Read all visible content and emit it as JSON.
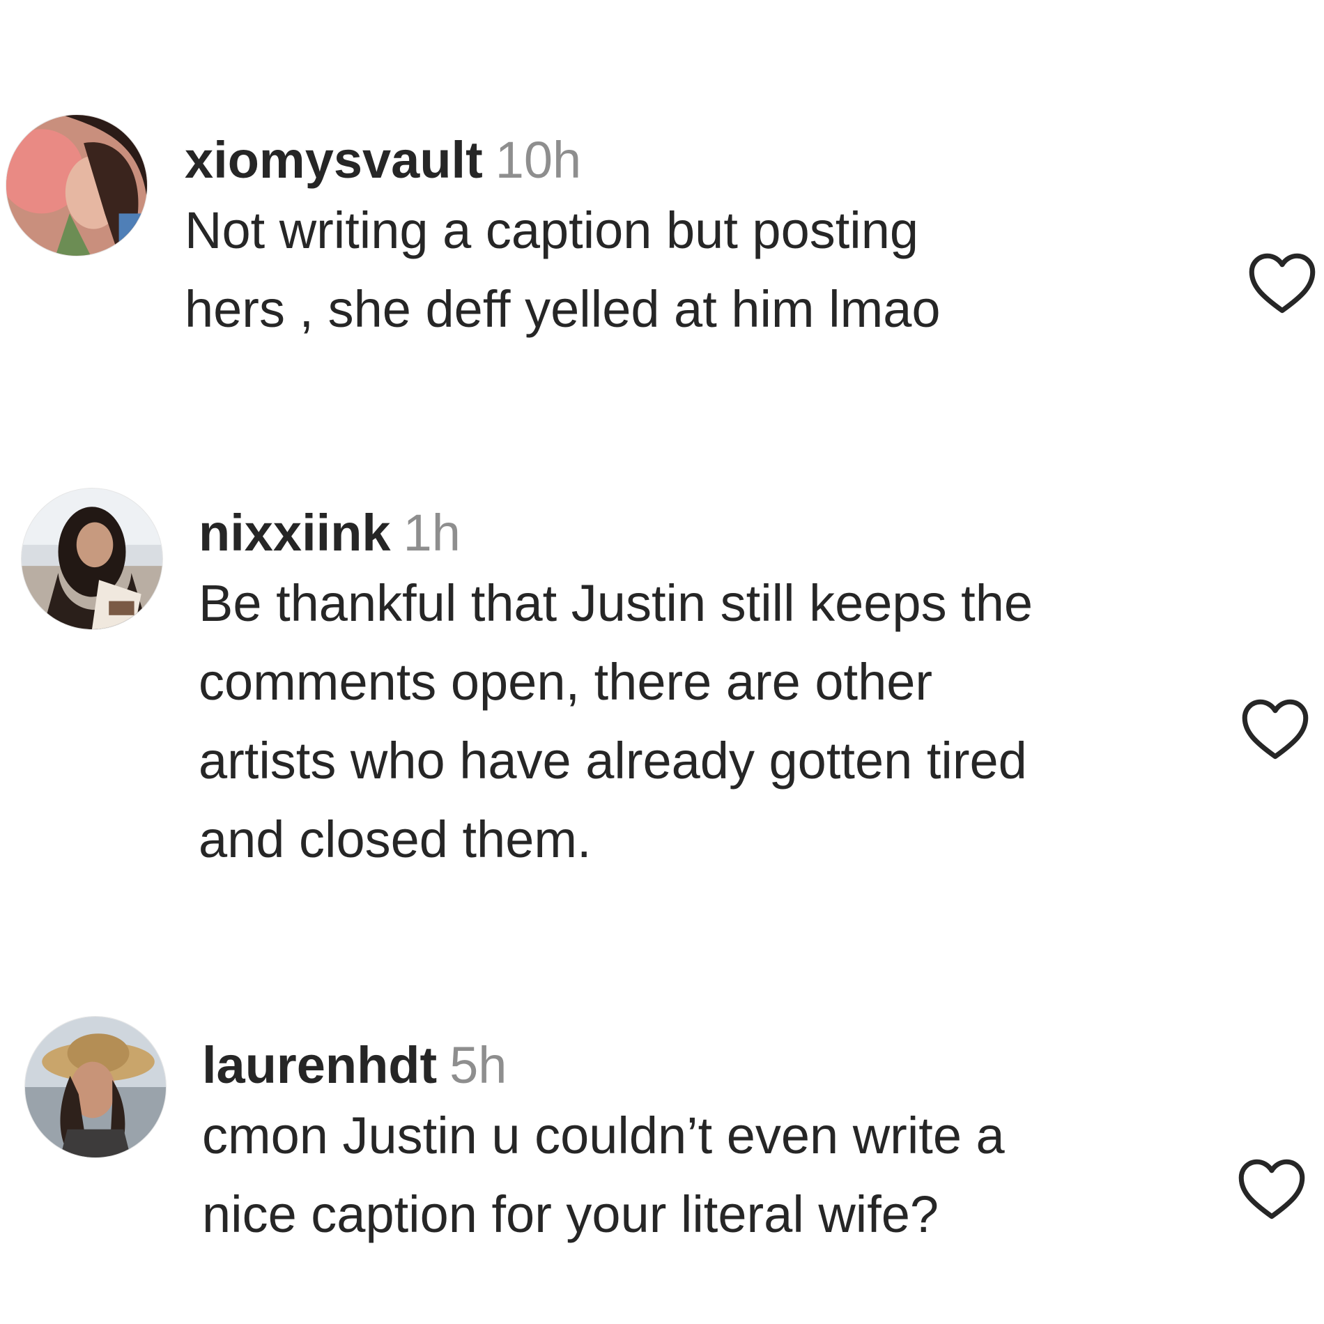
{
  "comments": [
    {
      "username": "xiomysvault",
      "time": "10h",
      "lines": [
        "Not writing a caption but posting",
        "hers , she deff yelled at him lmao"
      ]
    },
    {
      "username": "nixxiink",
      "time": "1h",
      "lines": [
        "Be thankful that Justin still keeps the",
        "comments open, there are other",
        "artists who have already gotten tired",
        "and closed them."
      ]
    },
    {
      "username": "laurenhdt",
      "time": "5h",
      "lines": [
        "cmon Justin u couldn’t even write a",
        "nice caption for your literal wife?"
      ]
    }
  ],
  "colors": {
    "text": "#262626",
    "timestamp": "#8e8e8e",
    "heart_outline": "#262626"
  },
  "icons": {
    "like": "heart-outline-icon"
  }
}
